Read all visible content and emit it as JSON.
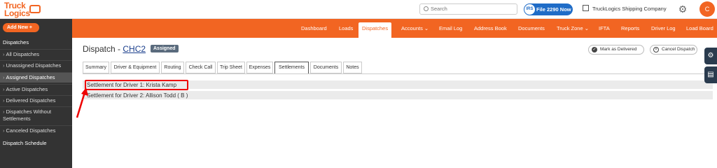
{
  "brand": {
    "line1": "Truck",
    "line2": "Logics"
  },
  "search": {
    "placeholder": "Search"
  },
  "file_button": {
    "icon_text": "IRS",
    "label": "File 2290 Now"
  },
  "company": {
    "name": "TruckLogics Shipping Company"
  },
  "user": {
    "initial": "C"
  },
  "sidebar": {
    "add_new": "Add New",
    "section": "Dispatches",
    "items": [
      {
        "label": "All Dispatches"
      },
      {
        "label": "Unassigned Dispatches"
      },
      {
        "label": "Assigned Dispatches"
      },
      {
        "label": "Active Dispatches"
      },
      {
        "label": "Delivered Dispatches"
      },
      {
        "label": "Dispatches Without",
        "label2": "Settlements"
      },
      {
        "label": "Canceled Dispatches"
      }
    ],
    "schedule": "Dispatch Schedule"
  },
  "nav": {
    "items": [
      {
        "label": "Dashboard"
      },
      {
        "label": "Loads"
      },
      {
        "label": "Dispatches"
      },
      {
        "label": "Accounts ⌄"
      },
      {
        "label": "Email Log"
      },
      {
        "label": "Address Book"
      },
      {
        "label": "Documents"
      },
      {
        "label": "Truck Zone ⌄"
      },
      {
        "label": "IFTA"
      },
      {
        "label": "Reports"
      },
      {
        "label": "Driver Log"
      },
      {
        "label": "Load Board"
      }
    ]
  },
  "page": {
    "title_prefix": "Dispatch - ",
    "code": "CHC2",
    "status": "Assigned",
    "mark_delivered": "Mark as Delivered",
    "cancel_dispatch": "Cancel Dispatch"
  },
  "tabs": [
    {
      "label": "Summary"
    },
    {
      "label": "Driver & Equipment"
    },
    {
      "label": "Routing"
    },
    {
      "label": "Check Call"
    },
    {
      "label": "Trip Sheet"
    },
    {
      "label": "Expenses"
    },
    {
      "label": "Settlements"
    },
    {
      "label": "Documents"
    },
    {
      "label": "Notes"
    }
  ],
  "settlements": [
    {
      "label": "Settlement for Driver 1: Krista Kamp"
    },
    {
      "label": "Settlement for Driver 2: Allison Todd ( B )"
    }
  ],
  "colors": {
    "accent": "#f26522",
    "highlight": "#e00000",
    "sidebar": "#333333"
  }
}
